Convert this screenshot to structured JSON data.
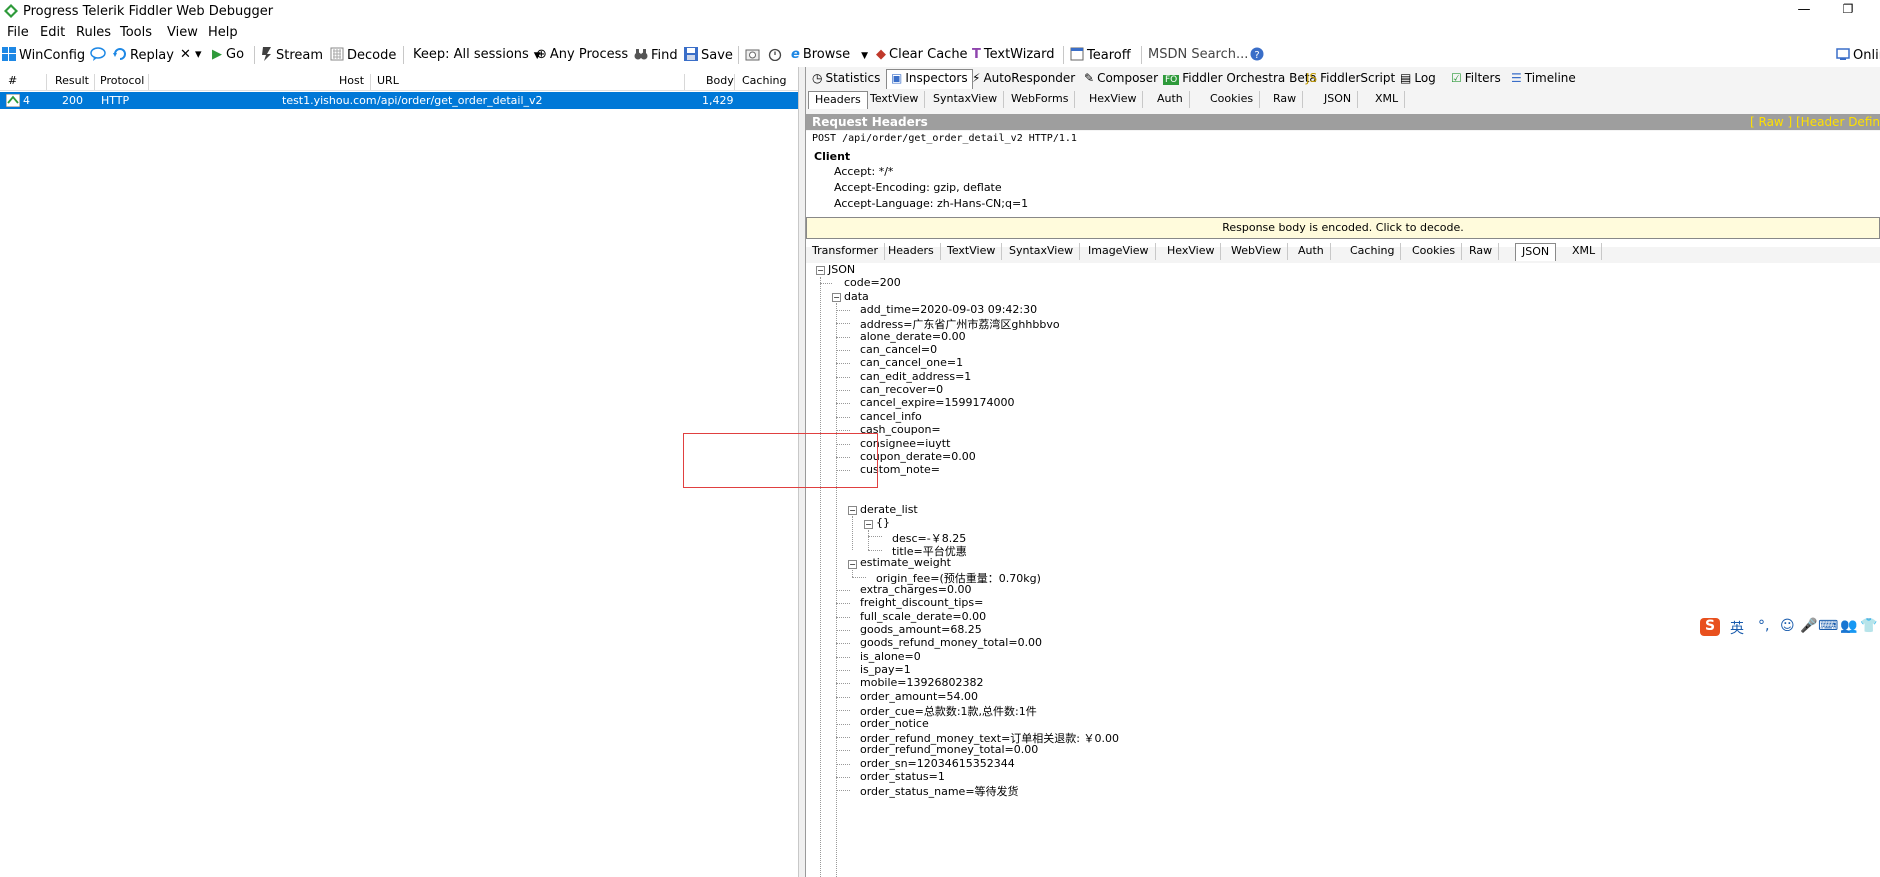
{
  "window": {
    "title": "Progress Telerik Fiddler Web Debugger",
    "min_glyph": "—",
    "restore_glyph": "❐"
  },
  "menu": [
    "File",
    "Edit",
    "Rules",
    "Tools",
    "View",
    "Help"
  ],
  "toolbar": {
    "winconfig": "WinConfig",
    "replay": "Replay",
    "remove": "✕ ▾",
    "go": "Go",
    "stream": "Stream",
    "decode": "Decode",
    "keep": "Keep: All sessions",
    "any_process": "Any Process",
    "find": "Find",
    "save": "Save",
    "browse": "Browse",
    "clear_cache": "Clear Cache",
    "textwizard": "TextWizard",
    "tearoff": "Tearoff",
    "msdn": "MSDN Search...",
    "online": "Onlin"
  },
  "sessions": {
    "columns": [
      "#",
      "Result",
      "Protocol",
      "Host",
      "URL",
      "Body",
      "Caching"
    ],
    "rows": [
      {
        "num": "4",
        "result": "200",
        "protocol": "HTTP",
        "host": "test1.yishou.com",
        "url": "/api/order/get_order_detail_v2",
        "body": "1,429",
        "caching": ""
      }
    ]
  },
  "main_tabs": [
    "Statistics",
    "Inspectors",
    "AutoResponder",
    "Composer",
    "Fiddler Orchestra Beta",
    "FiddlerScript",
    "Log",
    "Filters",
    "Timeline"
  ],
  "request_tabs": [
    "Headers",
    "TextView",
    "SyntaxView",
    "WebForms",
    "HexView",
    "Auth",
    "Cookies",
    "Raw",
    "JSON",
    "XML"
  ],
  "request_headers": {
    "title": "Request Headers",
    "raw_link": "[ Raw ]",
    "header_def_link": "[Header Definitions]",
    "request_line": "POST /api/order/get_order_detail_v2 HTTP/1.1",
    "group": "Client",
    "lines": [
      "Accept: */*",
      "Accept-Encoding: gzip, deflate",
      "Accept-Language: zh-Hans-CN;q=1"
    ]
  },
  "encoded_notice": "Response body is encoded. Click to decode.",
  "response_tabs": [
    "Transformer",
    "Headers",
    "TextView",
    "SyntaxView",
    "ImageView",
    "HexView",
    "WebView",
    "Auth",
    "Caching",
    "Cookies",
    "Raw",
    "JSON",
    "XML"
  ],
  "json_tree": {
    "root": "JSON",
    "code": "code=200",
    "data": "data",
    "data_items_a": [
      "add_time=2020-09-03 09:42:30",
      "address=广东省广州市荔湾区ghhbbvo",
      "alone_derate=0.00",
      "can_cancel=0",
      "can_cancel_one=1",
      "can_edit_address=1",
      "can_recover=0",
      "cancel_expire=1599174000",
      "cancel_info",
      "cash_coupon=",
      "consignee=iuytt",
      "coupon_derate=0.00",
      "custom_note="
    ],
    "derate_list": "derate_list",
    "obj": "{}",
    "desc": "desc=-￥8.25",
    "title": "title=平台优惠",
    "estimate_weight": "estimate_weight",
    "origin_fee": "origin_fee=(预估重量：0.70kg)",
    "data_items_b": [
      "extra_charges=0.00",
      "freight_discount_tips=",
      "full_scale_derate=0.00",
      "goods_amount=68.25",
      "goods_refund_money_total=0.00",
      "is_alone=0",
      "is_pay=1",
      "mobile=13926802382",
      "order_amount=54.00",
      "order_cue=总款数:1款,总件数:1件",
      "order_notice",
      "order_refund_money_text=订单相关退款: ￥0.00",
      "order_refund_money_total=0.00",
      "order_sn=12034615352344",
      "order_status=1",
      "order_status_name=等待发货"
    ]
  },
  "ime": {
    "lang": "英"
  }
}
